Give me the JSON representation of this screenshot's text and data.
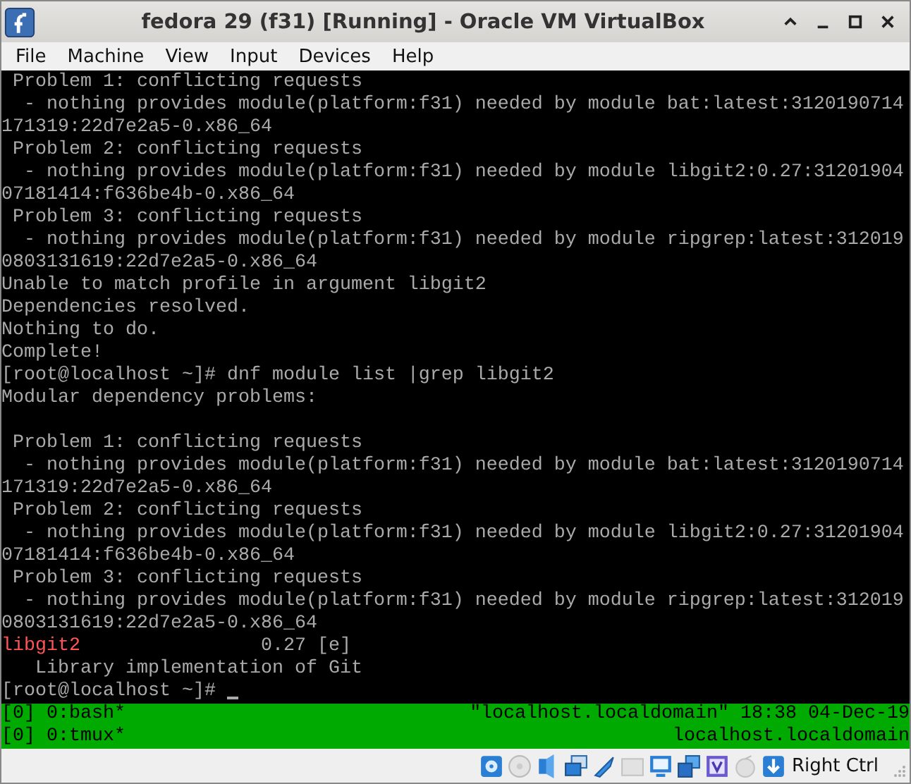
{
  "window": {
    "title": "fedora 29 (f31) [Running] - Oracle VM VirtualBox"
  },
  "menu": [
    "File",
    "Machine",
    "View",
    "Input",
    "Devices",
    "Help"
  ],
  "terminal": {
    "lines": [
      {
        "kind": "text",
        "text": " Problem 1: conflicting requests"
      },
      {
        "kind": "text",
        "text": "  - nothing provides module(platform:f31) needed by module bat:latest:3120190714"
      },
      {
        "kind": "text",
        "text": "171319:22d7e2a5-0.x86_64"
      },
      {
        "kind": "text",
        "text": " Problem 2: conflicting requests"
      },
      {
        "kind": "text",
        "text": "  - nothing provides module(platform:f31) needed by module libgit2:0.27:31201904"
      },
      {
        "kind": "text",
        "text": "07181414:f636be4b-0.x86_64"
      },
      {
        "kind": "text",
        "text": " Problem 3: conflicting requests"
      },
      {
        "kind": "text",
        "text": "  - nothing provides module(platform:f31) needed by module ripgrep:latest:312019"
      },
      {
        "kind": "text",
        "text": "0803131619:22d7e2a5-0.x86_64"
      },
      {
        "kind": "text",
        "text": "Unable to match profile in argument libgit2"
      },
      {
        "kind": "text",
        "text": "Dependencies resolved."
      },
      {
        "kind": "text",
        "text": "Nothing to do."
      },
      {
        "kind": "text",
        "text": "Complete!"
      },
      {
        "kind": "text",
        "text": "[root@localhost ~]# dnf module list |grep libgit2"
      },
      {
        "kind": "text",
        "text": "Modular dependency problems:"
      },
      {
        "kind": "blank"
      },
      {
        "kind": "text",
        "text": " Problem 1: conflicting requests"
      },
      {
        "kind": "text",
        "text": "  - nothing provides module(platform:f31) needed by module bat:latest:3120190714"
      },
      {
        "kind": "text",
        "text": "171319:22d7e2a5-0.x86_64"
      },
      {
        "kind": "text",
        "text": " Problem 2: conflicting requests"
      },
      {
        "kind": "text",
        "text": "  - nothing provides module(platform:f31) needed by module libgit2:0.27:31201904"
      },
      {
        "kind": "text",
        "text": "07181414:f636be4b-0.x86_64"
      },
      {
        "kind": "text",
        "text": " Problem 3: conflicting requests"
      },
      {
        "kind": "text",
        "text": "  - nothing provides module(platform:f31) needed by module ripgrep:latest:312019"
      },
      {
        "kind": "text",
        "text": "0803131619:22d7e2a5-0.x86_64"
      },
      {
        "kind": "match",
        "match": "libgit2",
        "text": "                0.27 [e]"
      },
      {
        "kind": "text",
        "text": "   Library implementation of Git"
      },
      {
        "kind": "prompt",
        "text": "[root@localhost ~]# "
      }
    ]
  },
  "tmux_status": [
    {
      "left": "[0] 0:bash*",
      "right": "\"localhost.localdomain\" 18:38 04-Dec-19"
    },
    {
      "left": "[0] 0:tmux*",
      "right": "localhost.localdomain"
    }
  ],
  "status_bar": {
    "host_key": "Right Ctrl"
  }
}
